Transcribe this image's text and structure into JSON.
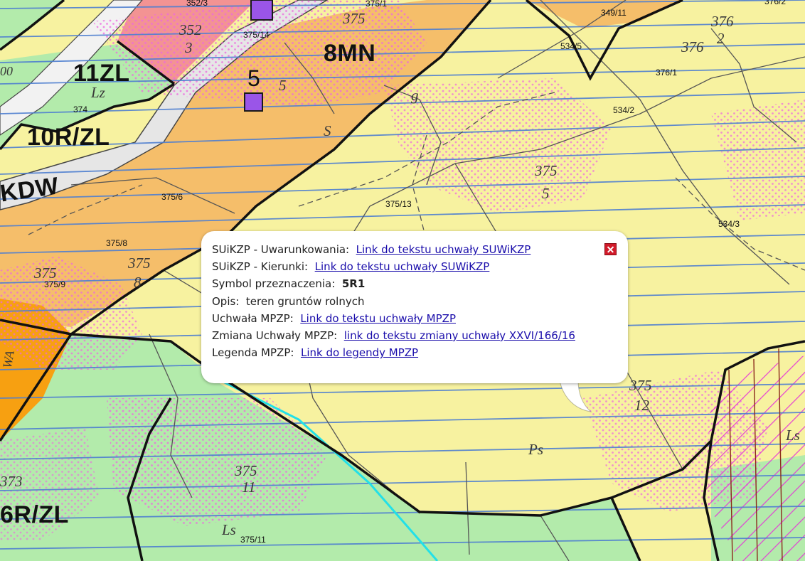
{
  "map": {
    "zones": {
      "z_8mn": "8MN",
      "z_11zl": "11ZL",
      "z_10rzl": "10R/ZL",
      "z_kdw": "KDW",
      "z_6rzl": "6R/ZL",
      "marker_5": "5"
    },
    "parcels": {
      "p_352_3": "352/3",
      "p_375_1": "375/1",
      "p_349_11": "349/11",
      "p_376_2": "376/2",
      "p_375_14": "375/14",
      "p_534_5": "534/5",
      "p_376_1": "376/1",
      "p_374": "374",
      "p_534_2": "534/2",
      "p_375_6": "375/6",
      "p_375_13": "375/13",
      "p_534_3": "534/3",
      "p_375_8": "375/8",
      "p_375_9": "375/9",
      "p_375_11": "375/11"
    },
    "handwritten": {
      "h_375_top": "375",
      "h_352": "352",
      "h_3": "3",
      "h_376_2a": "376",
      "h_2": "2",
      "h_376b": "376",
      "h_lz": "Lz",
      "h_s1": "S",
      "h_g": "g",
      "h_5a": "5",
      "h_375_5": "375",
      "h_5b": "5",
      "h_375_8": "375",
      "h_8": "8",
      "h_375_9": "375",
      "h_375_12": "375",
      "h_12": "12",
      "h_ps": "Ps",
      "h_375_11": "375",
      "h_11": "11",
      "h_ls": "Ls",
      "h_373": "373",
      "h_ls2": "Ls",
      "h_wa": "WA",
      "h_00": "00"
    },
    "colors": {
      "yellow_area": "#f7f2a0",
      "orange_area": "#f5be6a",
      "dark_orange_area": "#f7a011",
      "green_area": "#b3ebab",
      "salmon_area": "#f39393",
      "road": "#e6e6e6",
      "blue_lines": "#4f7fd0",
      "magenta_dots": "#ee66e0",
      "cyan_line": "#22e0e8",
      "marker_purple": "#9a55e8"
    }
  },
  "popup": {
    "rows": [
      {
        "label": "SUiKZP - Uwarunkowania:",
        "link": "Link do tekstu uchwały SUWiKZP"
      },
      {
        "label": "SUiKZP - Kierunki:",
        "link": "Link do tekstu uchwały SUWiKZP"
      },
      {
        "label": "Symbol przeznaczenia:",
        "value": "5R1"
      },
      {
        "label": "Opis:",
        "value": "teren gruntów rolnych"
      },
      {
        "label": "Uchwała MPZP:",
        "link": "Link do tekstu uchwały MPZP"
      },
      {
        "label": "Zmiana Uchwały MPZP:",
        "link": "link do tekstu zmiany uchwały XXVI/166/16"
      },
      {
        "label": "Legenda MPZP:",
        "link": "Link do legendy MPZP"
      }
    ],
    "close_icon": "close-icon"
  }
}
